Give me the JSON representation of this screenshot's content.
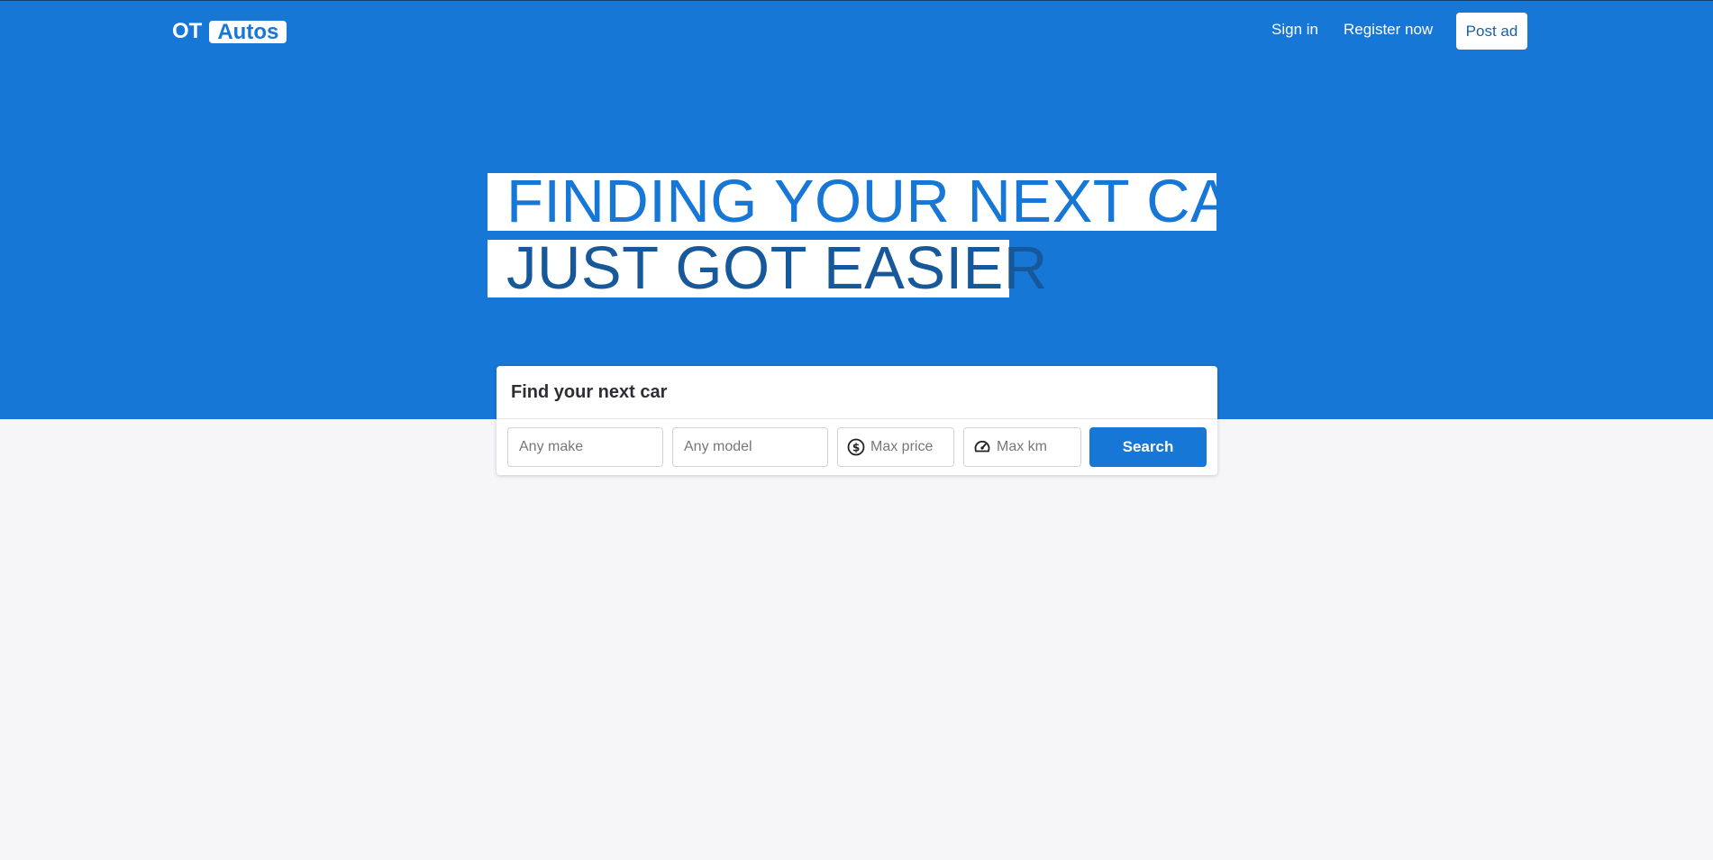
{
  "brand": {
    "prefix": "OT",
    "name": "Autos"
  },
  "nav": {
    "sign_in": "Sign in",
    "register": "Register now",
    "post_ad": "Post ad"
  },
  "hero": {
    "line1": "FINDING YOUR NEXT CAR",
    "line2": "JUST GOT EASIER"
  },
  "search": {
    "title": "Find your next car",
    "make_placeholder": "Any make",
    "model_placeholder": "Any model",
    "price_placeholder": "Max price",
    "km_placeholder": "Max km",
    "button": "Search",
    "price_icon": "dollar-circle-icon",
    "km_icon": "speedometer-icon"
  },
  "colors": {
    "primary": "#1677d6",
    "headline_dark": "#17589a",
    "background": "#f6f6f8"
  }
}
